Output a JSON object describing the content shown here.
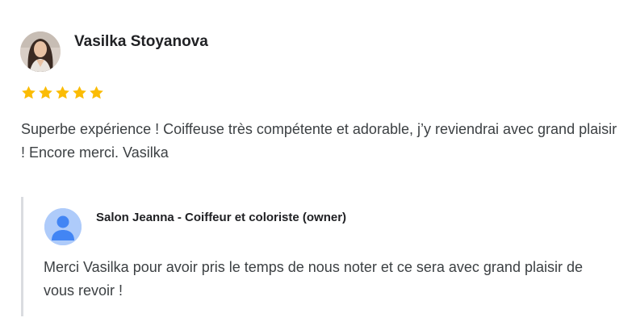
{
  "review": {
    "reviewer_name": "Vasilka Stoyanova",
    "rating": 5,
    "rating_max": 5,
    "star_color": "#fbbc04",
    "text": "Superbe expérience ! Coiffeuse très compétente et adorable, j’y reviendrai avec grand plaisir ! Encore merci. Vasilka"
  },
  "owner_reply": {
    "owner_name": "Salon Jeanna - Coiffeur et coloriste (owner)",
    "text": "Merci Vasilka pour avoir pris le temps de nous noter et ce sera avec grand plaisir de vous revoir !"
  },
  "icons": {
    "reviewer_avatar": "profile-photo",
    "owner_avatar": "default-person-icon",
    "star": "star-icon"
  },
  "colors": {
    "text_primary": "#202124",
    "text_body": "#3c4043",
    "reply_border": "#dadce0",
    "owner_avatar_bg": "#aecbfa",
    "owner_avatar_fg": "#4285f4"
  }
}
